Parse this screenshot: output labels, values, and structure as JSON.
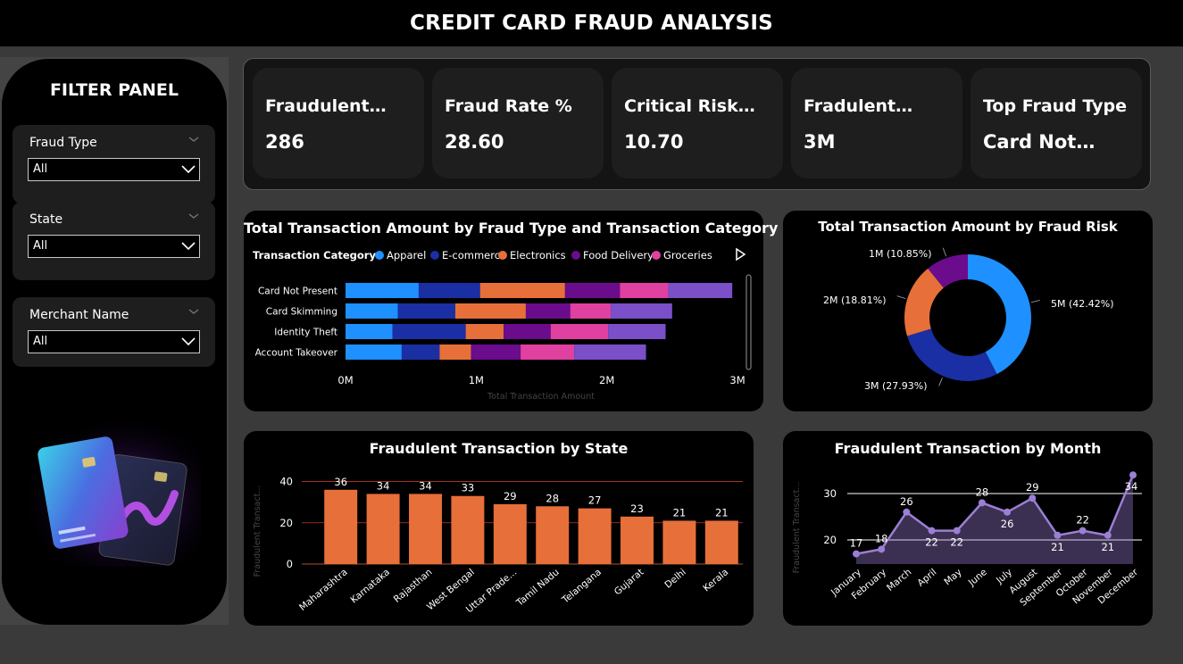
{
  "header": {
    "title": "CREDIT CARD FRAUD ANALYSIS"
  },
  "filters": {
    "title": "FILTER PANEL",
    "slicers": [
      {
        "label": "Fraud Type",
        "value": "All"
      },
      {
        "label": "State",
        "value": "All"
      },
      {
        "label": "Merchant Name",
        "value": "All"
      }
    ]
  },
  "kpis": [
    {
      "title": "Fraudulent…",
      "value": "286"
    },
    {
      "title": "Fraud Rate %",
      "value": "28.60"
    },
    {
      "title": "Critical Risk…",
      "value": "10.70"
    },
    {
      "title": "Fradulent…",
      "value": "3M"
    },
    {
      "title": "Top Fraud Type",
      "value": "Card Not…"
    }
  ],
  "colors": {
    "apparel": "#1e90ff",
    "ecommerce": "#1a2fa3",
    "electronics": "#e76f3a",
    "food_delivery": "#6a0c8c",
    "groceries": "#e040a0",
    "other": "#7a4fc8",
    "bar_orange": "#e76f3a",
    "line_purple": "#9b7fd4"
  },
  "chart_data": [
    {
      "type": "bar",
      "orientation": "horizontal-stacked",
      "title": "Total Transaction Amount by Fraud Type and Transaction Category",
      "legend_title": "Transaction Category",
      "legend_placement": "top",
      "xlabel": "Total Transaction Amount",
      "x_ticks": [
        "0M",
        "1M",
        "2M",
        "3M"
      ],
      "xlim": [
        0,
        3
      ],
      "categories": [
        "Card Not Present",
        "Card Skimming",
        "Identity Theft",
        "Account Takeover"
      ],
      "series": [
        {
          "name": "Apparel",
          "color": "#1e90ff",
          "values": [
            0.56,
            0.4,
            0.36,
            0.43
          ]
        },
        {
          "name": "E-commerce",
          "color": "#1a2fa3",
          "values": [
            0.47,
            0.44,
            0.56,
            0.29
          ]
        },
        {
          "name": "Electronics",
          "color": "#e76f3a",
          "values": [
            0.65,
            0.54,
            0.29,
            0.24
          ]
        },
        {
          "name": "Food Delivery",
          "color": "#6a0c8c",
          "values": [
            0.42,
            0.34,
            0.36,
            0.38
          ]
        },
        {
          "name": "Groceries",
          "color": "#e040a0",
          "values": [
            0.37,
            0.31,
            0.44,
            0.41
          ]
        },
        {
          "color": "#7a4fc8",
          "values": [
            0.49,
            0.47,
            0.44,
            0.55
          ]
        }
      ]
    },
    {
      "type": "pie",
      "style": "donut",
      "title": "Total Transaction Amount by Fraud Risk",
      "slices": [
        {
          "label": "5M (42.42%)",
          "value": 42.42,
          "color": "#1e90ff"
        },
        {
          "label": "3M (27.93%)",
          "value": 27.93,
          "color": "#1a2fa3"
        },
        {
          "label": "2M (18.81%)",
          "value": 18.81,
          "color": "#e76f3a"
        },
        {
          "label": "1M (10.85%)",
          "value": 10.85,
          "color": "#6a0c8c"
        }
      ]
    },
    {
      "type": "bar",
      "title": "Fraudulent Transaction by State",
      "ylabel": "Fraudulent Transact...",
      "ylim": [
        0,
        45
      ],
      "y_ticks": [
        0,
        20,
        40
      ],
      "categories": [
        "Maharashtra",
        "Karnataka",
        "Rajasthan",
        "West Bengal",
        "Uttar Prade...",
        "Tamil Nadu",
        "Telangana",
        "Gujarat",
        "Delhi",
        "Kerala"
      ],
      "values": [
        36,
        34,
        34,
        33,
        29,
        28,
        27,
        23,
        21,
        21
      ]
    },
    {
      "type": "area",
      "title": "Fraudulent Transaction by Month",
      "ylabel": "Fraudulent Transact...",
      "ylim": [
        15,
        35
      ],
      "y_ticks": [
        20,
        30
      ],
      "categories": [
        "January",
        "February",
        "March",
        "April",
        "May",
        "June",
        "July",
        "August",
        "September",
        "October",
        "November",
        "December"
      ],
      "values": [
        17,
        18,
        26,
        22,
        22,
        28,
        26,
        29,
        21,
        22,
        21,
        34
      ]
    }
  ]
}
